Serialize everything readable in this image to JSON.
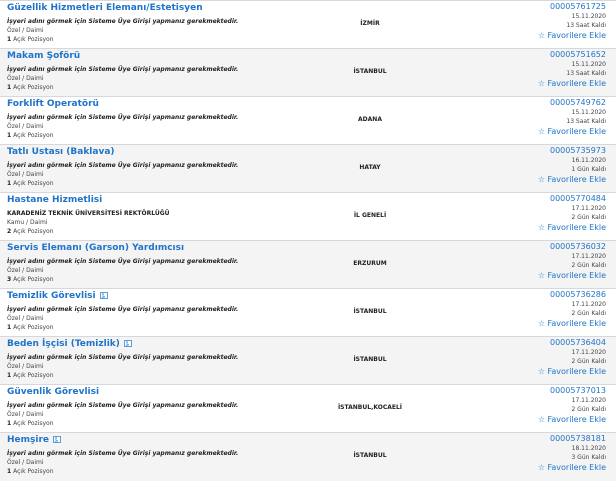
{
  "listings": [
    {
      "title": "Güzellik Hizmetleri Elemanı/Estetisyen",
      "icon": "",
      "employer": "İşyeri adını görmek için Sisteme Üye Girişi yapmanız gerekmektedir.",
      "employer_italic": true,
      "type": "Özel / Daimi",
      "positions_count": "1",
      "positions_label": "Açık Pozisyon",
      "location": "İZMİR",
      "id": "00005761725",
      "date": "15.11.2020",
      "remaining": "13 Saat Kaldı",
      "fav_icon": "star-icon",
      "fav_label": "Favorilere Ekle"
    },
    {
      "title": "Makam Şoförü",
      "icon": "",
      "employer": "İşyeri adını görmek için Sisteme Üye Girişi yapmanız gerekmektedir.",
      "employer_italic": true,
      "type": "Özel / Daimi",
      "positions_count": "1",
      "positions_label": "Açık Pozisyon",
      "location": "İSTANBUL",
      "id": "00005751652",
      "date": "15.11.2020",
      "remaining": "13 Saat Kaldı",
      "fav_icon": "star-icon",
      "fav_label": "Favorilere Ekle"
    },
    {
      "title": "Forklift Operatörü",
      "icon": "",
      "employer": "İşyeri adını görmek için Sisteme Üye Girişi yapmanız gerekmektedir.",
      "employer_italic": true,
      "type": "Özel / Daimi",
      "positions_count": "1",
      "positions_label": "Açık Pozisyon",
      "location": "ADANA",
      "id": "00005749762",
      "date": "15.11.2020",
      "remaining": "13 Saat Kaldı",
      "fav_icon": "star-icon",
      "fav_label": "Favorilere Ekle"
    },
    {
      "title": "Tatlı Ustası (Baklava)",
      "icon": "",
      "employer": "İşyeri adını görmek için Sisteme Üye Girişi yapmanız gerekmektedir.",
      "employer_italic": true,
      "type": "Özel / Daimi",
      "positions_count": "1",
      "positions_label": "Açık Pozisyon",
      "location": "HATAY",
      "id": "00005735973",
      "date": "16.11.2020",
      "remaining": "1 Gün Kaldı",
      "fav_icon": "star-icon",
      "fav_label": "Favorilere Ekle"
    },
    {
      "title": "Hastane Hizmetlisi",
      "icon": "",
      "employer": "KARADENİZ TEKNİK ÜNİVERSİTESİ REKTÖRLÜĞÜ",
      "employer_italic": false,
      "type": "Kamu / Daimi",
      "positions_count": "2",
      "positions_label": "Açık Pozisyon",
      "location": "İL GENELİ",
      "id": "00005770484",
      "date": "17.11.2020",
      "remaining": "2 Gün Kaldı",
      "fav_icon": "star-icon",
      "fav_label": "Favorilere Ekle"
    },
    {
      "title": "Servis Elemanı (Garson) Yardımcısı",
      "icon": "",
      "employer": "İşyeri adını görmek için Sisteme Üye Girişi yapmanız gerekmektedir.",
      "employer_italic": true,
      "type": "Özel / Daimi",
      "positions_count": "3",
      "positions_label": "Açık Pozisyon",
      "location": "ERZURUM",
      "id": "00005736032",
      "date": "17.11.2020",
      "remaining": "2 Gün Kaldı",
      "fav_icon": "star-icon",
      "fav_label": "Favorilere Ekle"
    },
    {
      "title": "Temizlik Görevlisi",
      "icon": "disability-icon",
      "employer": "İşyeri adını görmek için Sisteme Üye Girişi yapmanız gerekmektedir.",
      "employer_italic": true,
      "type": "Özel / Daimi",
      "positions_count": "1",
      "positions_label": "Açık Pozisyon",
      "location": "İSTANBUL",
      "id": "00005736286",
      "date": "17.11.2020",
      "remaining": "2 Gün Kaldı",
      "fav_icon": "star-icon",
      "fav_label": "Favorilere Ekle"
    },
    {
      "title": "Beden İşçisi (Temizlik)",
      "icon": "disability-icon",
      "employer": "İşyeri adını görmek için Sisteme Üye Girişi yapmanız gerekmektedir.",
      "employer_italic": true,
      "type": "Özel / Daimi",
      "positions_count": "1",
      "positions_label": "Açık Pozisyon",
      "location": "İSTANBUL",
      "id": "00005736404",
      "date": "17.11.2020",
      "remaining": "2 Gün Kaldı",
      "fav_icon": "star-icon",
      "fav_label": "Favorilere Ekle"
    },
    {
      "title": "Güvenlik Görevlisi",
      "icon": "",
      "employer": "İşyeri adını görmek için Sisteme Üye Girişi yapmanız gerekmektedir.",
      "employer_italic": true,
      "type": "Özel / Daimi",
      "positions_count": "1",
      "positions_label": "Açık Pozisyon",
      "location": "İSTANBUL,KOCAELİ",
      "id": "00005737013",
      "date": "17.11.2020",
      "remaining": "2 Gün Kaldı",
      "fav_icon": "star-icon",
      "fav_label": "Favorilere Ekle"
    },
    {
      "title": "Hemşire",
      "icon": "disability-icon",
      "employer": "İşyeri adını görmek için Sisteme Üye Girişi yapmanız gerekmektedir.",
      "employer_italic": true,
      "type": "Özel / Daimi",
      "positions_count": "1",
      "positions_label": "Açık Pozisyon",
      "location": "İSTANBUL",
      "id": "00005738181",
      "date": "18.11.2020",
      "remaining": "3 Gün Kaldı",
      "fav_icon": "star-icon",
      "fav_label": "Favorilere Ekle"
    }
  ],
  "colors": {
    "link": "#1f74c9",
    "alt_row": "#f4f4f4",
    "border": "#d8d8d8"
  }
}
